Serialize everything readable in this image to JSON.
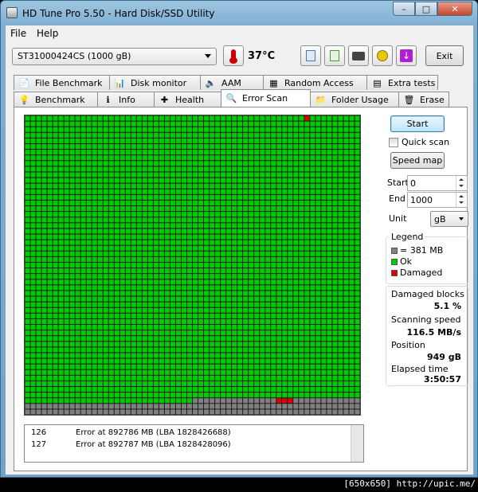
{
  "window": {
    "title": "HD Tune Pro 5.50 - Hard Disk/SSD Utility",
    "controls": {
      "minimize": "–",
      "maximize": "□",
      "close": "✕"
    }
  },
  "menu": {
    "file": "File",
    "help": "Help"
  },
  "toolbar": {
    "drive": "ST31000424CS (1000 gB)",
    "temperature": "37°C",
    "exit_label": "Exit",
    "icons": [
      "copy-info-icon",
      "copy-text-icon",
      "screenshot-icon",
      "options-icon",
      "save-icon"
    ]
  },
  "tabs_back": [
    {
      "label": "File Benchmark",
      "icon": "file-benchmark-icon",
      "glyph": "📄"
    },
    {
      "label": "Disk monitor",
      "icon": "disk-monitor-icon",
      "glyph": "📊"
    },
    {
      "label": "AAM",
      "icon": "speaker-icon",
      "glyph": "🔈"
    },
    {
      "label": "Random Access",
      "icon": "random-access-icon",
      "glyph": "▦"
    },
    {
      "label": "Extra tests",
      "icon": "extra-tests-icon",
      "glyph": "▤"
    }
  ],
  "tabs_front": [
    {
      "label": "Benchmark",
      "icon": "benchmark-icon",
      "glyph": "💡"
    },
    {
      "label": "Info",
      "icon": "info-icon",
      "glyph": "ℹ"
    },
    {
      "label": "Health",
      "icon": "health-icon",
      "glyph": "✚"
    },
    {
      "label": "Error Scan",
      "icon": "magnifier-icon",
      "glyph": "🔍"
    },
    {
      "label": "Folder Usage",
      "icon": "folder-icon",
      "glyph": "📁"
    },
    {
      "label": "Erase",
      "icon": "trash-icon",
      "glyph": "🗑"
    }
  ],
  "controls": {
    "start_label": "Start",
    "quick_scan_label": "Quick scan",
    "speed_map_label": "Speed map",
    "start_field_label": "Start",
    "start_value": "0",
    "end_field_label": "End",
    "end_value": "1000",
    "unit_label": "Unit",
    "unit_value": "gB"
  },
  "legend": {
    "title": "Legend",
    "items": [
      {
        "label": "= 381 MB",
        "color": "#808080"
      },
      {
        "label": "Ok",
        "color": "#00cc00"
      },
      {
        "label": "Damaged",
        "color": "#dd0000"
      }
    ]
  },
  "stats": {
    "damaged_blocks_label": "Damaged blocks",
    "damaged_blocks_value": "5.1 %",
    "scanning_speed_label": "Scanning speed",
    "scanning_speed_value": "116.5 MB/s",
    "position_label": "Position",
    "position_value": "949 gB",
    "elapsed_label": "Elapsed time",
    "elapsed_value": "3:50:57"
  },
  "log": [
    {
      "index": "126",
      "message": "Error at 892786 MB (LBA 1828426688)"
    },
    {
      "index": "127",
      "message": "Error at 892787 MB (LBA 1828428096)"
    }
  ],
  "scan_map": {
    "colors": {
      "ok": "#00cc00",
      "unscanned": "#808080",
      "damaged": "#dd0000",
      "gridline": "#1c1c1c"
    },
    "columns": 60,
    "rows": 53,
    "ok_full_rows": 50,
    "ok_cells_in_row_51": 30,
    "damaged_cells": [
      [
        0,
        50
      ],
      [
        50,
        45
      ],
      [
        50,
        46
      ],
      [
        50,
        47
      ]
    ]
  },
  "caption": "[650x650] http://upic.me/"
}
